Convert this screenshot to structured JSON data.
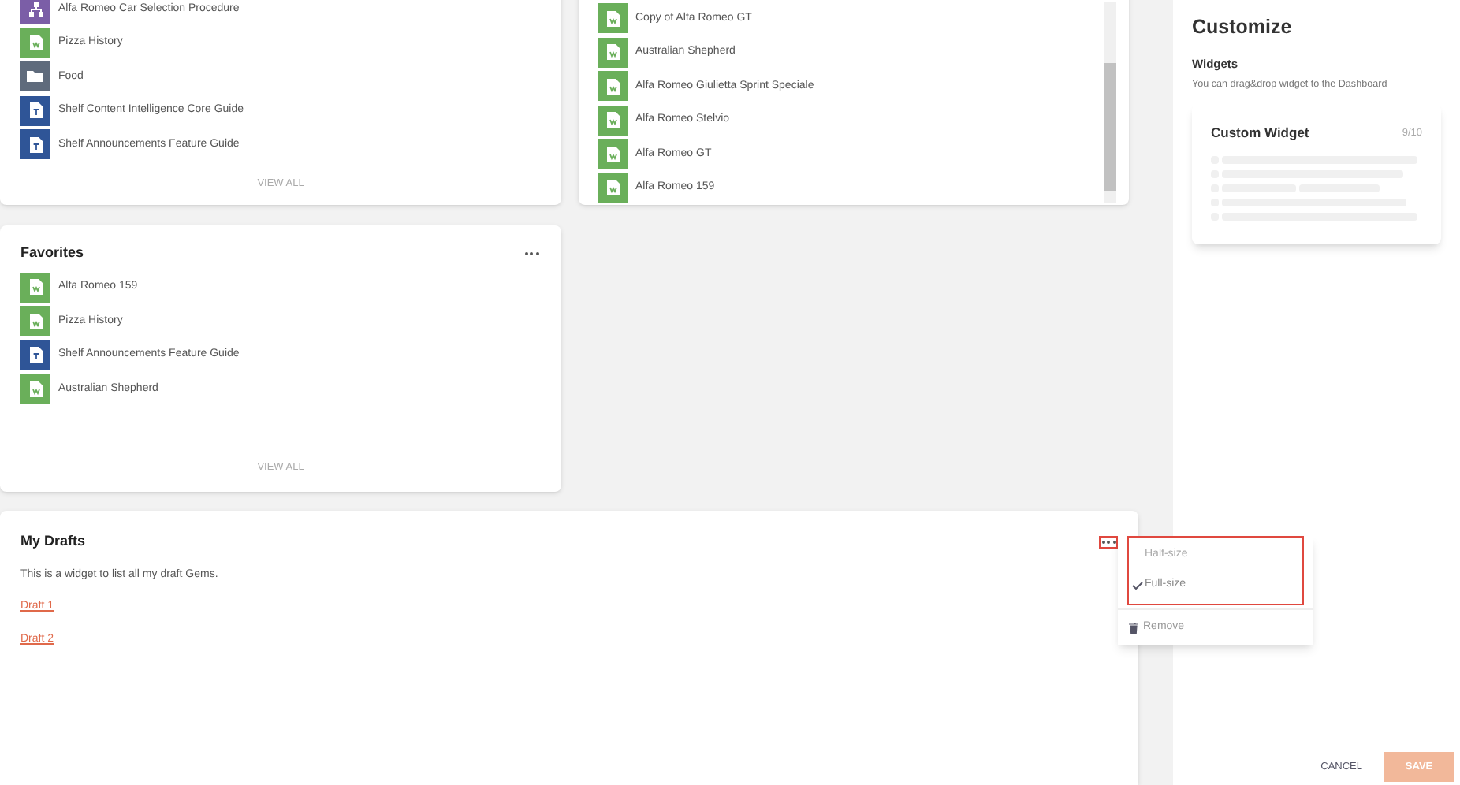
{
  "recent": {
    "items": [
      {
        "kind": "workflow",
        "title": "Alfa Romeo Car Selection Procedure"
      },
      {
        "kind": "doc",
        "title": "Pizza History"
      },
      {
        "kind": "folder",
        "title": "Food"
      },
      {
        "kind": "guide",
        "title": "Shelf Content Intelligence Core Guide"
      },
      {
        "kind": "guide",
        "title": "Shelf Announcements Feature Guide"
      }
    ],
    "view_all": "VIEW ALL"
  },
  "list2": {
    "items": [
      {
        "kind": "doc",
        "title": "Copy of Alfa Romeo GT"
      },
      {
        "kind": "doc",
        "title": "Australian Shepherd"
      },
      {
        "kind": "doc",
        "title": "Alfa Romeo Giulietta Sprint Speciale"
      },
      {
        "kind": "doc",
        "title": "Alfa Romeo Stelvio"
      },
      {
        "kind": "doc",
        "title": "Alfa Romeo GT"
      },
      {
        "kind": "doc",
        "title": "Alfa Romeo 159"
      }
    ]
  },
  "favorites": {
    "title": "Favorites",
    "items": [
      {
        "kind": "doc",
        "title": "Alfa Romeo 159"
      },
      {
        "kind": "doc",
        "title": "Pizza History"
      },
      {
        "kind": "guide",
        "title": "Shelf Announcements Feature Guide"
      },
      {
        "kind": "doc",
        "title": "Australian Shepherd"
      }
    ],
    "view_all": "VIEW ALL"
  },
  "drafts": {
    "title": "My Drafts",
    "description": "This is a widget to list all my draft Gems.",
    "links": [
      "Draft 1",
      "Draft 2"
    ]
  },
  "menu": {
    "sizes": [
      {
        "label": "Half-size",
        "selected": false
      },
      {
        "label": "Full-size",
        "selected": true
      }
    ],
    "remove": "Remove"
  },
  "customize": {
    "title": "Customize",
    "section": "Widgets",
    "hint": "You can drag&drop widget to the Dashboard",
    "widget": {
      "title": "Custom Widget",
      "count": "9/10"
    },
    "cancel": "CANCEL",
    "save": "SAVE"
  }
}
